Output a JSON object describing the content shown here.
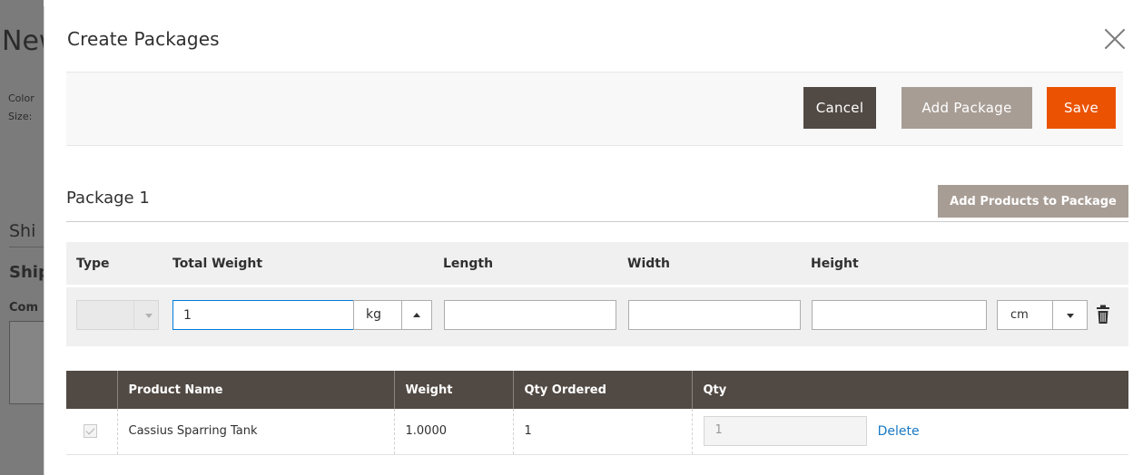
{
  "background": {
    "title": "New",
    "color_label": "Color",
    "size_label": "Size:",
    "section_shi": "Shi",
    "section_ship": "Ship",
    "com_label": "Com"
  },
  "modal": {
    "title": "Create Packages",
    "close_icon": "close-icon"
  },
  "toolbar": {
    "cancel_label": "Cancel",
    "add_package_label": "Add Package",
    "save_label": "Save"
  },
  "package": {
    "title": "Package 1",
    "add_products_label": "Add Products to Package",
    "labels": {
      "type": "Type",
      "total_weight": "Total Weight",
      "length": "Length",
      "width": "Width",
      "height": "Height"
    },
    "values": {
      "type": "",
      "total_weight": "1",
      "weight_unit": "kg",
      "length": "",
      "width": "",
      "height": "",
      "dimension_unit": "cm"
    },
    "delete_icon": "trash-icon"
  },
  "items_table": {
    "headers": [
      "",
      "Product Name",
      "Weight",
      "Qty Ordered",
      "Qty"
    ],
    "rows": [
      {
        "checked": true,
        "product_name": "Cassius Sparring Tank",
        "weight": "1.0000",
        "qty_ordered": "1",
        "qty": "1",
        "delete_label": "Delete"
      }
    ]
  },
  "colors": {
    "accent_save": "#eb5202",
    "dark_button": "#514943",
    "disabled_button": "#a79d95",
    "link": "#1979c3"
  }
}
